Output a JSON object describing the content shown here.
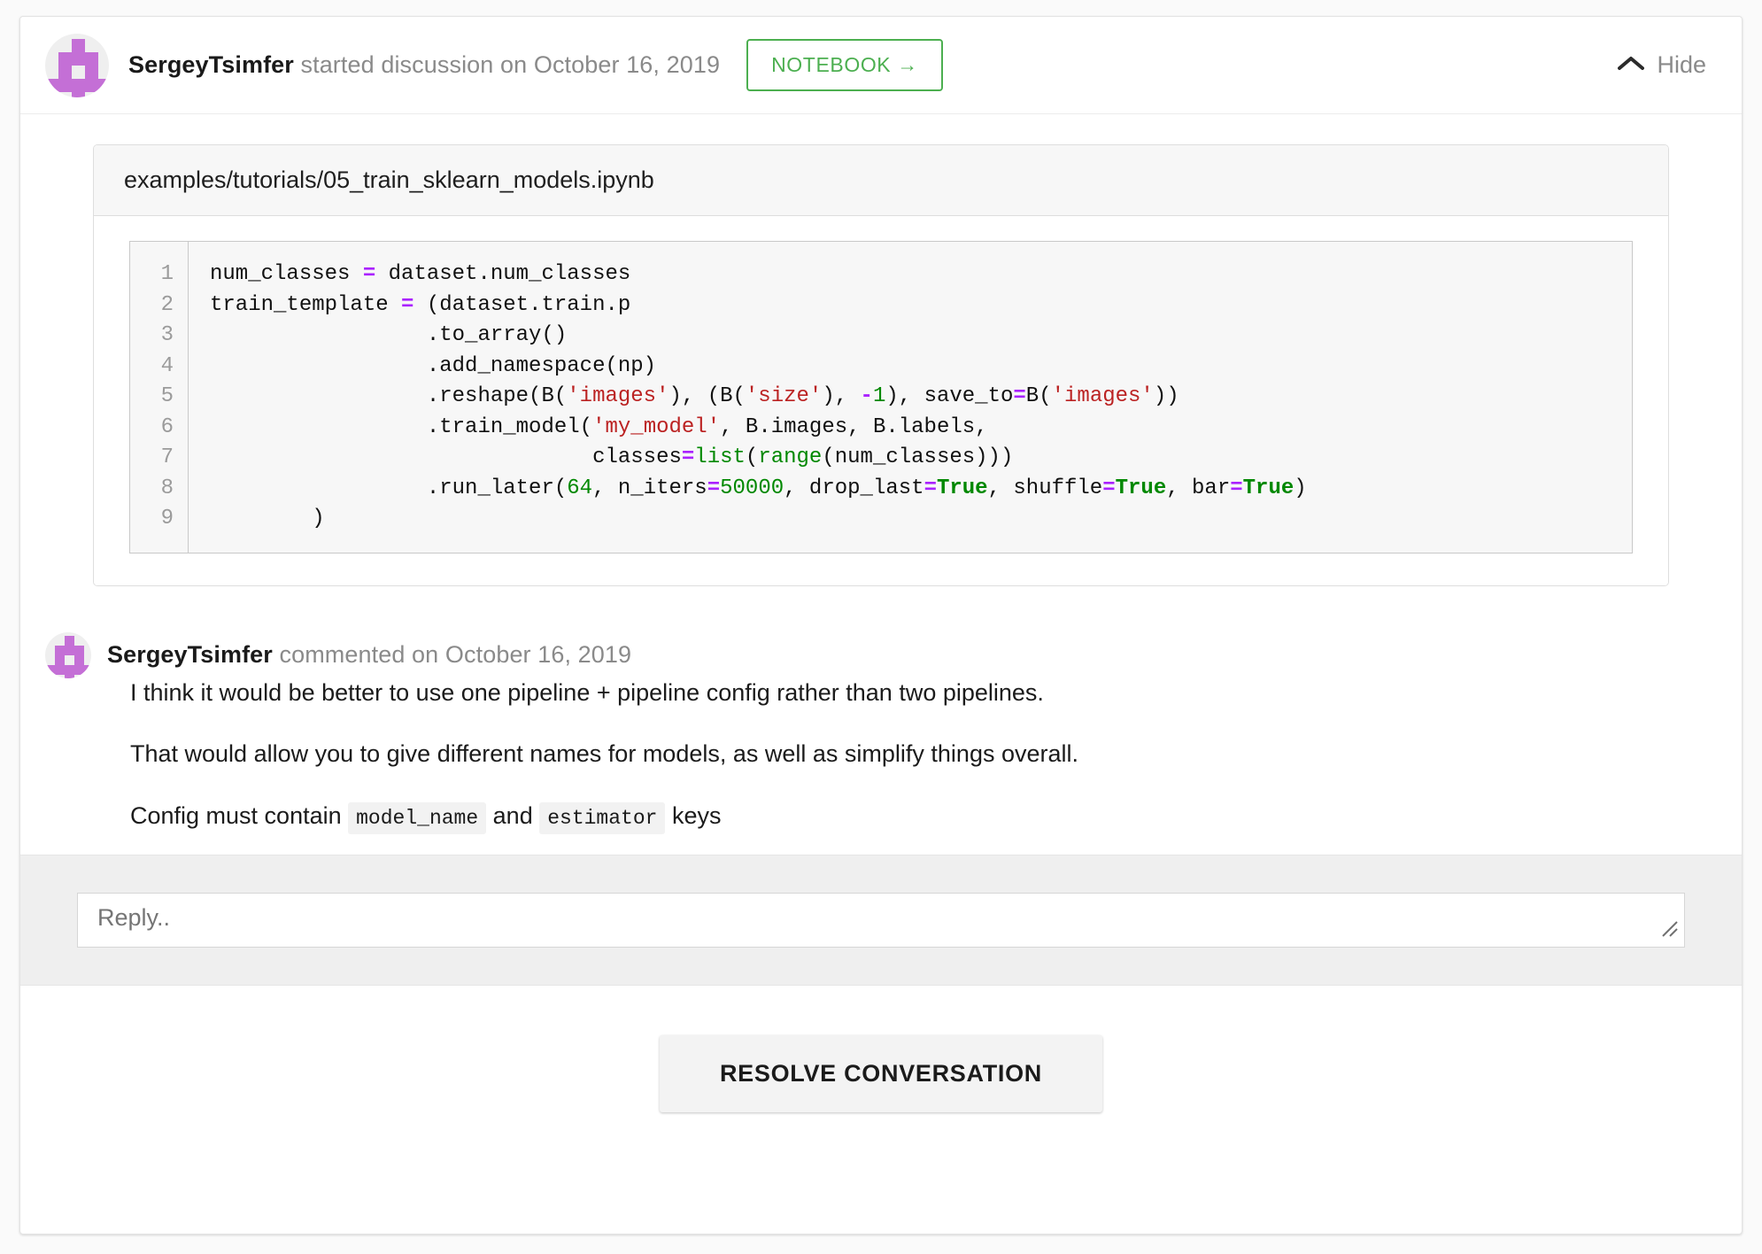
{
  "header": {
    "avatar_name": "user-avatar",
    "author": "SergeyTsimfer",
    "action_text": " started discussion on ",
    "date": "October 16, 2019",
    "notebook_button": "NOTEBOOK →",
    "hide_label": "Hide",
    "accent_green": "#4caf50"
  },
  "file": {
    "path": "examples/tutorials/05_train_sklearn_models.ipynb",
    "line_numbers": [
      "1",
      "2",
      "3",
      "4",
      "5",
      "6",
      "7",
      "8",
      "9"
    ],
    "code_lines": [
      "num_classes = dataset.num_classes",
      "train_template = (dataset.train.p",
      "                 .to_array()",
      "                 .add_namespace(np)",
      "                 .reshape(B('images'), (B('size'), -1), save_to=B('images'))",
      "                 .train_model('my_model', B.images, B.labels,",
      "                              classes=list(range(num_classes)))",
      "                 .run_later(64, n_iters=50000, drop_last=True, shuffle=True, bar=True)",
      "        )"
    ]
  },
  "comment": {
    "author": "SergeyTsimfer",
    "action_text": " commented on ",
    "date": "October 16, 2019",
    "paragraph_1": "I think it would be better to use one pipeline + pipeline config rather than two pipelines.",
    "paragraph_2": "That would allow you to give different names for models, as well as simplify things overall.",
    "paragraph_3_prefix": "Config must contain ",
    "paragraph_3_code_1": "model_name",
    "paragraph_3_middle": " and ",
    "paragraph_3_code_2": "estimator",
    "paragraph_3_suffix": " keys"
  },
  "reply": {
    "placeholder": "Reply.."
  },
  "footer": {
    "resolve_label": "RESOLVE CONVERSATION"
  }
}
